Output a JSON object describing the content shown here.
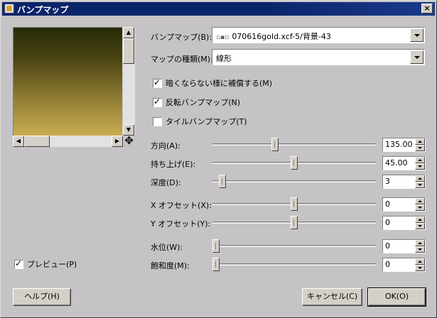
{
  "window": {
    "title": "バンプマップ",
    "close_glyph": "×"
  },
  "preview": {
    "checkbox_label": "プレビュー(P)",
    "checked": true
  },
  "bump_map": {
    "label": "バンプマップ(B):",
    "value": "070616gold.xcf-5/背景-43"
  },
  "map_type": {
    "label": "マップの種類(M):",
    "value": "線形"
  },
  "options": [
    {
      "label": "暗くならない様に補償する(M)",
      "checked": true
    },
    {
      "label": "反転バンプマップ(N)",
      "checked": true
    },
    {
      "label": "タイルバンプマップ(T)",
      "checked": false
    }
  ],
  "sliders": {
    "direction": {
      "label": "方向(A):",
      "value": "135.00",
      "level": 0.375
    },
    "elevation": {
      "label": "持ち上げ(E):",
      "value": "45.00",
      "level": 0.5
    },
    "depth": {
      "label": "深度(D):",
      "value": "3",
      "level": 0.04
    },
    "x_offset": {
      "label": "X オフセット(X):",
      "value": "0",
      "level": 0.5
    },
    "y_offset": {
      "label": "Y オフセット(Y):",
      "value": "0",
      "level": 0.5
    },
    "waterlevel": {
      "label": "水位(W):",
      "value": "0",
      "level": 0.0
    },
    "ambient": {
      "label": "飽和度(M):",
      "value": "0",
      "level": 0.0
    }
  },
  "buttons": {
    "help": "ヘルプ(H)",
    "cancel": "キャンセル(C)",
    "ok": "OK(O)"
  }
}
